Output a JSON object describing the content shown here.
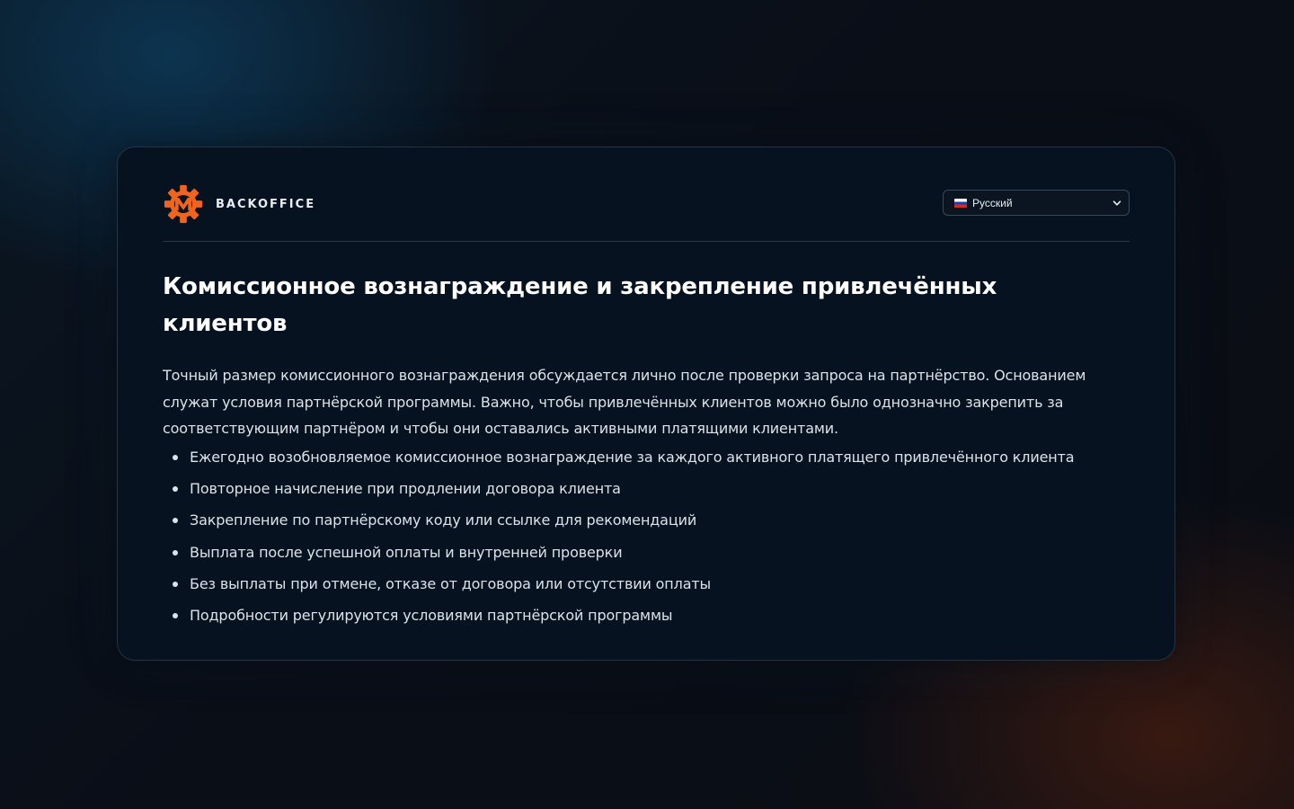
{
  "brand": {
    "name": "BACKOFFICE",
    "logo_icon": "gear-m-logo-icon",
    "accent_color": "#f0641e"
  },
  "language_select": {
    "selected": "Русский",
    "flag_icon": "russia-flag-icon"
  },
  "content": {
    "title": "Комиссионное вознаграждение и закрепление привлечённых клиентов",
    "intro": "Точный размер комиссионного вознаграждения обсуждается лично после проверки запроса на партнёрство. Основанием служат условия партнёрской программы. Важно, чтобы привлечённых клиентов можно было однозначно закрепить за соответствующим партнёром и чтобы они оставались активными платящими клиентами.",
    "features": [
      "Ежегодно возобновляемое комиссионное вознаграждение за каждого активного платящего привлечённого клиента",
      "Повторное начисление при продлении договора клиента",
      "Закрепление по партнёрскому коду или ссылке для рекомендаций",
      "Выплата после успешной оплаты и внутренней проверки",
      "Без выплаты при отмене, отказе от договора или отсутствии оплаты",
      "Подробности регулируются условиями партнёрской программы"
    ]
  }
}
